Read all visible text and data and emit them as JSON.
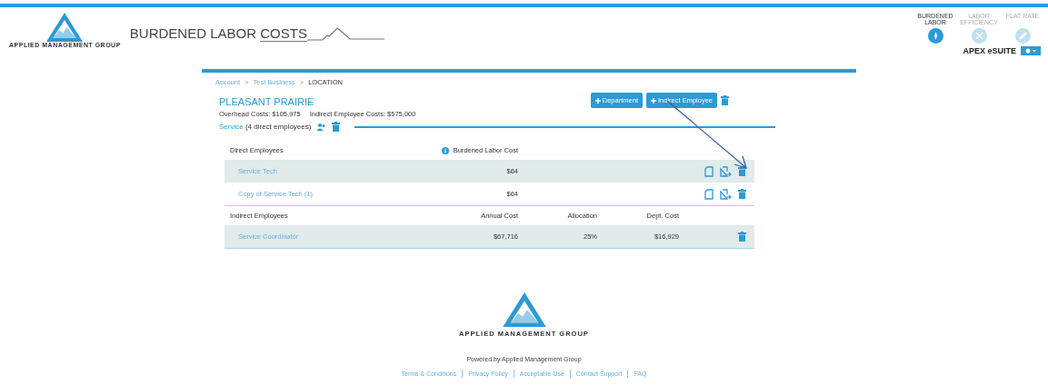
{
  "header": {
    "logo_text": "APPLIED MANAGEMENT GROUP",
    "title_plain": "BURDENED LABOR ",
    "title_underlined": "COSTS"
  },
  "app_nav": [
    {
      "label": "BURDENED LABOR",
      "kind": "compass",
      "selected": true
    },
    {
      "label": "LABOR EFFICIENCY",
      "kind": "tools",
      "selected": false
    },
    {
      "label": "FLAT RATE",
      "kind": "link",
      "selected": false
    }
  ],
  "suite": {
    "label": "APEX eSUITE"
  },
  "breadcrumb_separator": ">",
  "breadcrumb": [
    {
      "label": "Account",
      "current": false
    },
    {
      "label": "Test Business",
      "current": false
    },
    {
      "label": "LOCATION",
      "current": true
    }
  ],
  "location": {
    "name": "PLEASANT PRAIRIE",
    "overhead": "Overhead Costs: $105,975",
    "indirect_costs": "Indirect Employee Costs: $575,000"
  },
  "buttons": [
    "Department",
    "Indirect Employee"
  ],
  "department": {
    "name": "Service",
    "count": "(4 direct employees)"
  },
  "direct": {
    "columns": [
      "Direct Employees",
      "Burdened Labor Cost"
    ],
    "rows": [
      {
        "name": "Service Tech",
        "suffix": "",
        "cost": "$64",
        "shaded": true
      },
      {
        "name": "Copy of Service Tech",
        "suffix": "(1)",
        "cost": "$64",
        "shaded": false
      }
    ]
  },
  "indirect": {
    "columns": [
      "Indirect Employees",
      "Annual Cost",
      "Allocation",
      "Dept. Cost"
    ],
    "rows": [
      {
        "name": "Service Coordinator",
        "annual": "$67,716",
        "allocation": "25%",
        "dept_cost": "$16,929",
        "shaded": true
      }
    ]
  },
  "footer": {
    "logo_text": "APPLIED MANAGEMENT GROUP",
    "powered": "Powered by Applied Management Group",
    "links": [
      "Terms & Conditions",
      "Privacy Policy",
      "Acceptable Use",
      "Contact Support",
      "FAQ"
    ]
  }
}
